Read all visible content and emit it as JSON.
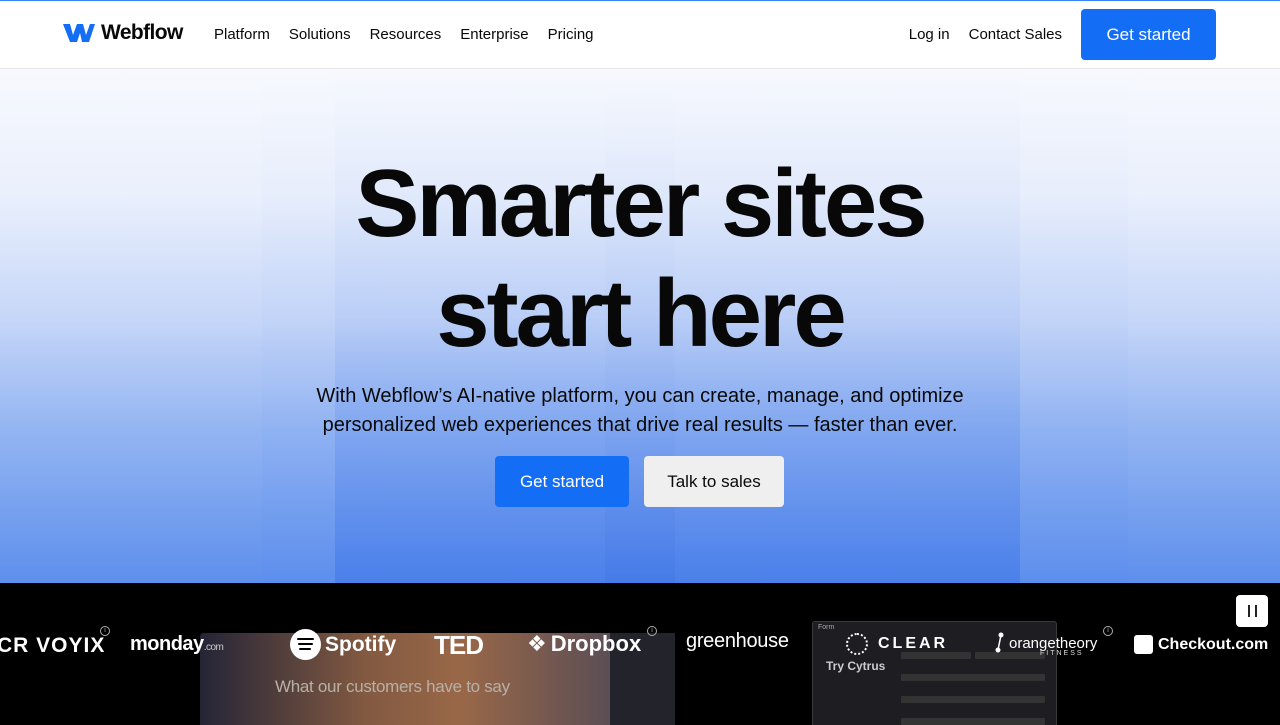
{
  "nav": {
    "brand": "Webflow",
    "links": [
      "Platform",
      "Solutions",
      "Resources",
      "Enterprise",
      "Pricing"
    ],
    "login": "Log in",
    "contact": "Contact Sales",
    "cta": "Get started"
  },
  "hero": {
    "headline_line1": "Smarter sites",
    "headline_line2": "start here",
    "subhead": "With Webflow’s AI-native platform, you can create, manage, and optimize personalized web experiences that drive real results — faster than ever.",
    "primary_button": "Get started",
    "secondary_button": "Talk to sales"
  },
  "logo_strip": {
    "logos": {
      "voyix": "CR VOYIX",
      "monday": "monday",
      "monday_suffix": ".com",
      "spotify": "Spotify",
      "ted": "TED",
      "dropbox": "Dropbox",
      "greenhouse": "greenhouse",
      "clear": "CLEAR",
      "orangetheory": "orangetheory",
      "orangetheory_sub": "FITNESS",
      "checkout": "Checkout.com"
    },
    "preview_text": "What our customers have to say",
    "preview_form_title": "Form",
    "preview_form_sub": "Try Cytrus"
  },
  "colors": {
    "accent": "#146ef5",
    "strip_bg": "#000000"
  }
}
